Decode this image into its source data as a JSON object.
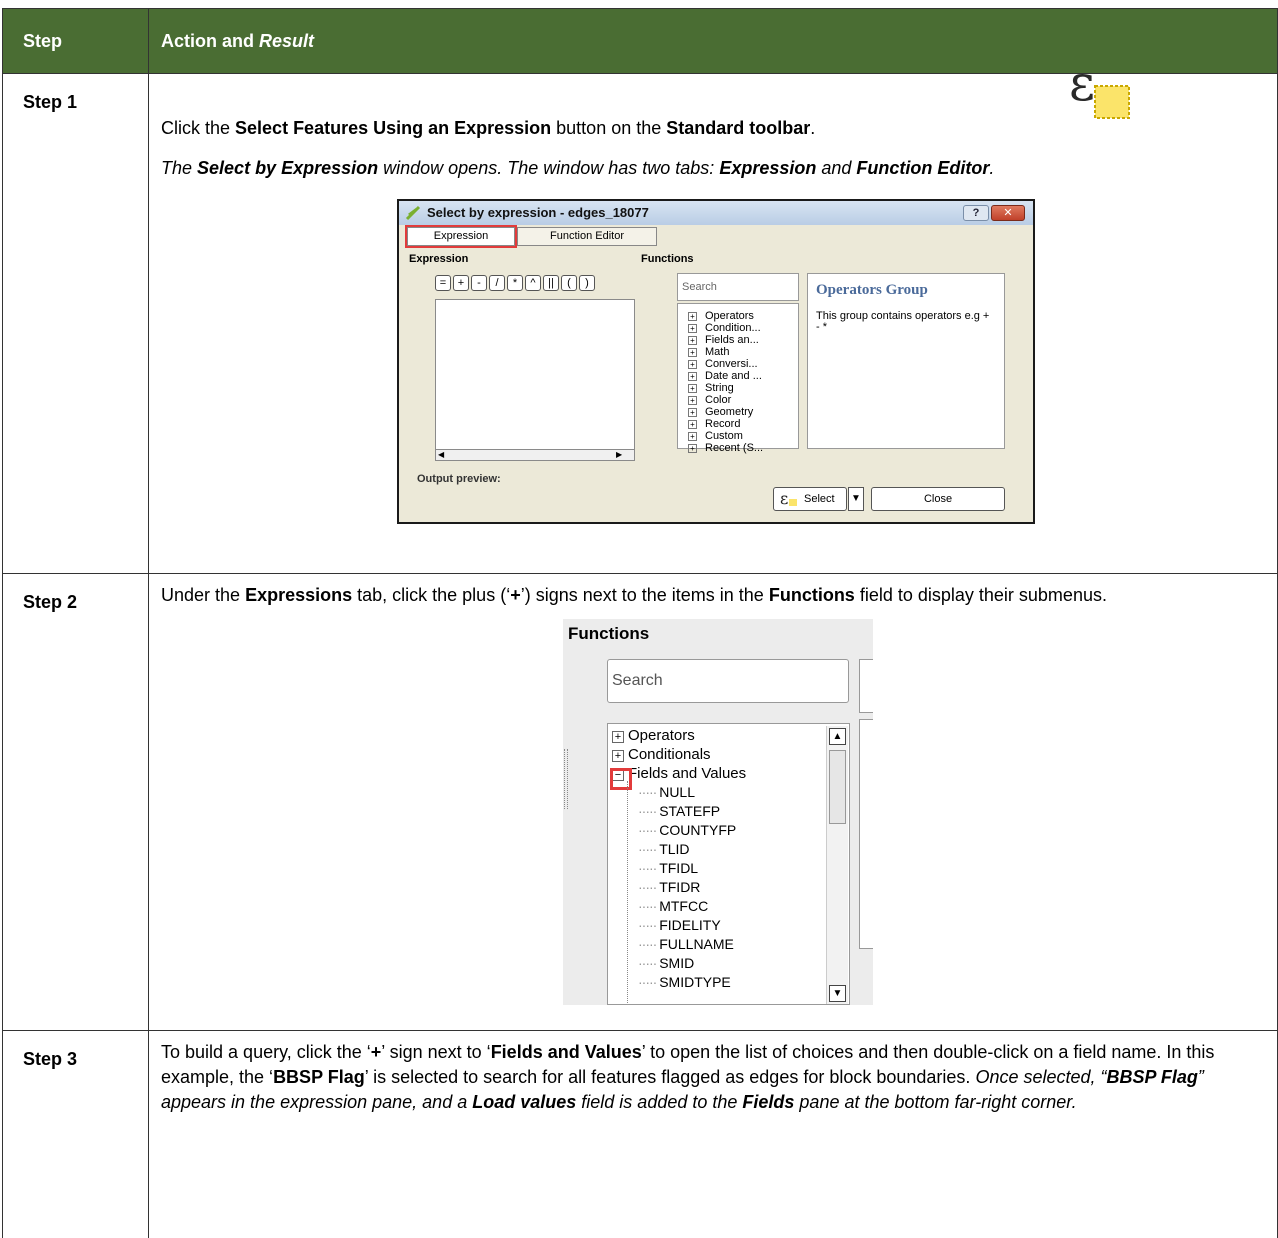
{
  "header": {
    "step": "Step",
    "action": "Action and ",
    "result": "Result"
  },
  "step1": {
    "label": "Step 1",
    "line1_a": "Click the ",
    "line1_b": "Select Features Using an Expression",
    "line1_c": " button on the ",
    "line1_d": "Standard toolbar",
    "line1_e": ".",
    "line2_a": "The ",
    "line2_b": "Select by Expression",
    "line2_c": " window opens. The window has two tabs: ",
    "line2_d": "Expression",
    "line2_e": " and ",
    "line2_f": "Function Editor",
    "line2_g": "."
  },
  "dialog": {
    "title": "Select by expression - edges_18077",
    "help": "?",
    "tabs": [
      "Expression",
      "Function Editor"
    ],
    "expression_header": "Expression",
    "functions_header": "Functions",
    "operators": [
      "=",
      "+",
      "-",
      "/",
      "*",
      "^",
      "||",
      "(",
      ")"
    ],
    "search_placeholder": "Search",
    "functions": [
      "Operators",
      "Condition...",
      "Fields an...",
      "Math",
      "Conversi...",
      "Date and ...",
      "String",
      "Color",
      "Geometry",
      "Record",
      "Custom",
      "Recent (S..."
    ],
    "help_title": "Operators Group",
    "help_body": "This group contains operators e.g + - *",
    "output_preview": "Output preview:",
    "select_label": "Select",
    "close_label": "Close"
  },
  "step2": {
    "label": "Step 2",
    "t1": "Under the ",
    "t2": "Expressions",
    "t3": " tab, click the plus (‘",
    "t4": "+",
    "t5": "’) signs next to the items in the ",
    "t6": "Functions",
    "t7": " field to display their submenus."
  },
  "functions_panel": {
    "header": "Functions",
    "search_placeholder": "Search",
    "groups": [
      "Operators",
      "Conditionals",
      "Fields and Values"
    ],
    "fields": [
      "NULL",
      "STATEFP",
      "COUNTYFP",
      "TLID",
      "TFIDL",
      "TFIDR",
      "MTFCC",
      "FIDELITY",
      "FULLNAME",
      "SMID",
      "SMIDTYPE"
    ]
  },
  "step3": {
    "label": "Step 3",
    "t1": "To build a query, click the ‘",
    "t2": "+",
    "t3": "’ sign next to ‘",
    "t4": "Fields and Values",
    "t5": "’ to open the list of choices and then double-click on a field name. In this example, the ‘",
    "t6": "BBSP Flag",
    "t7": "’ is selected to search for all features flagged as edges for block boundaries. ",
    "t8": "Once selected, “",
    "t9": "BBSP Flag",
    "t10": "” appears in the expression pane, and a ",
    "t11": "Load values",
    "t12": " field is added to the ",
    "t13": "Fields",
    "t14": " pane at the bottom far-right corner."
  }
}
